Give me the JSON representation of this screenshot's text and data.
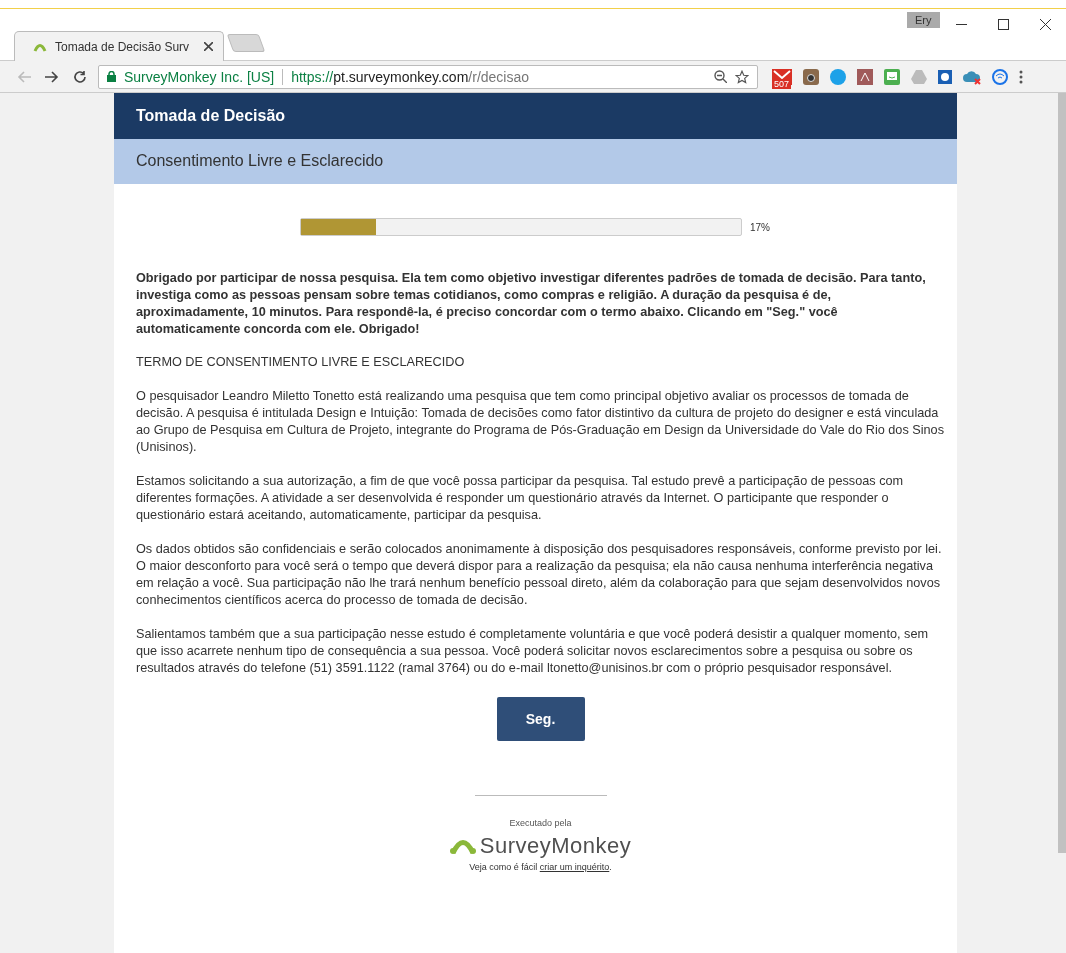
{
  "browser": {
    "tab": {
      "title": "Tomada de Decisão Surv",
      "selected": true
    },
    "profile": "Ery",
    "address": {
      "site": "SurveyMonkey Inc. [US]",
      "scheme": "https://",
      "host": "pt.surveymonkey.com",
      "path": "/r/decisao"
    },
    "mail_badge": "507"
  },
  "survey": {
    "title": "Tomada de Decisão",
    "page_title": "Consentimento Livre e Esclarecido",
    "progress": {
      "level": 0.17,
      "reading": "17%"
    },
    "intro": "Obrigado por participar de nossa pesquisa. Ela tem como objetivo investigar diferentes padrões de tomada de decisão. Para tanto, investiga como as pessoas pensam sobre temas cotidianos, como compras e religião. A duração da pesquisa é de, aproximadamente, 10 minutos. Para respondê-la, é preciso concordar com o termo abaixo. Clicando em \"Seg.\" você automaticamente concorda com ele. Obrigado!",
    "heading": "TERMO DE CONSENTIMENTO LIVRE E ESCLARECIDO",
    "paragraphs": [
      "O pesquisador Leandro Miletto Tonetto está realizando uma pesquisa que tem como principal objetivo avaliar os processos de tomada de decisão. A pesquisa é intitulada Design e Intuição: Tomada de decisões como fator distintivo da cultura de projeto do designer e está vinculada ao Grupo de Pesquisa em Cultura de Projeto, integrante do Programa de Pós-Graduação em Design da Universidade do Vale do Rio dos Sinos (Unisinos).",
      "Estamos solicitando a sua autorização, a fim de que você possa participar da pesquisa.  Tal estudo prevê a participação de pessoas com diferentes formações. A atividade a ser desenvolvida é responder um questionário através da Internet. O participante que responder o questionário estará aceitando, automaticamente, participar da pesquisa.",
      "Os dados obtidos são confidenciais e serão colocados anonimamente à disposição dos pesquisadores responsáveis, conforme previsto por lei. O maior desconforto para você será o tempo que deverá dispor para a realização da pesquisa; ela não causa nenhuma interferência negativa em relação a você. Sua participação não lhe trará nenhum benefício pessoal direto, além da colaboração para que sejam desenvolvidos novos conhecimentos científicos acerca do processo de tomada de decisão.",
      "Salientamos também que a sua participação nesse estudo é completamente voluntária e que você poderá desistir a qualquer momento, sem que isso acarrete nenhum tipo de consequência a sua pessoa. Você poderá solicitar novos esclarecimentos sobre a pesquisa ou sobre os resultados através do telefone (51) 3591.1122 (ramal 3764) ou do e-mail ltonetto@unisinos.br com o próprio pesquisador responsável."
    ],
    "next_button": "Seg.",
    "footer": {
      "powered_by": "Executado pela",
      "logo": "SurveyMonkey",
      "cta_before": "Veja como é fácil ",
      "cta_link": "criar um inquérito",
      "cta_after": "."
    }
  }
}
